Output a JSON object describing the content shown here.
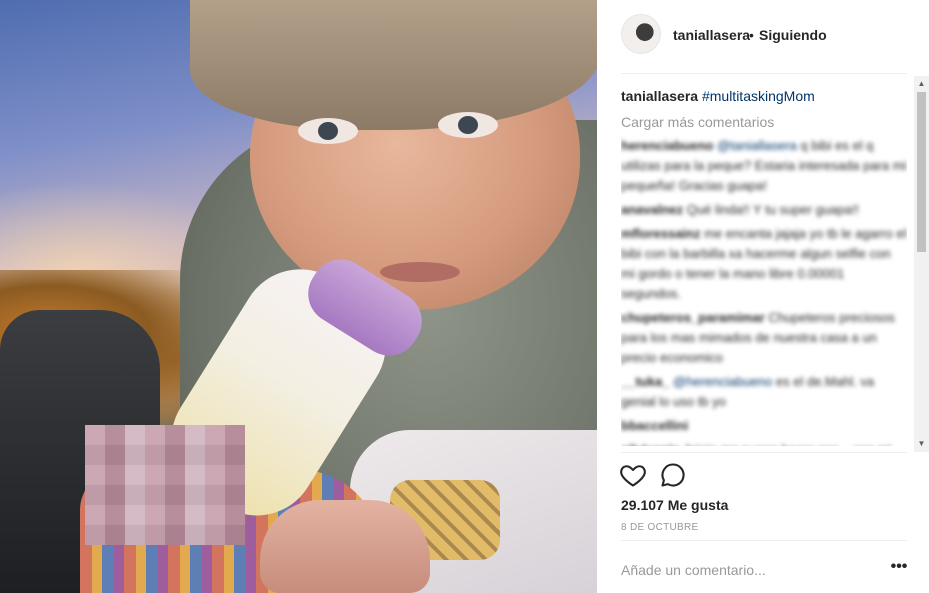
{
  "post": {
    "username": "taniallasera",
    "follow_dot": "•",
    "follow_status": "Siguiendo",
    "caption_user": "taniallasera",
    "caption_tag": "#multitaskingMom",
    "load_more": "Cargar más comentarios",
    "comments": [
      {
        "user": "herenciabueno",
        "mention": "@taniallasera",
        "text": "q bibi es el q utilizas para la peque? Estaria interesada para mi pequeña! Gracias guapa!"
      },
      {
        "user": "anavalnez",
        "mention": "",
        "text": "Qué linda!! Y tu super guapa!!"
      },
      {
        "user": "mfloressainz",
        "mention": "",
        "text": "me encanta jajaja yo tb le agarro el bibi con la barbilla xa hacerme algun selfie con mi gordo o tener la mano libre 0.00001 segundos."
      },
      {
        "user": "chupeteros_paramimar",
        "mention": "",
        "text": "Chupeteros preciosos para los mas mimados de nuestra casa a un precio economico"
      },
      {
        "user": "__tuka_",
        "mention": "@herenciabueno",
        "text": "es el de.Mahl. va genial lo uso tb yo"
      },
      {
        "user": "bbaccellini",
        "mention": "",
        "text": ""
      },
      {
        "user": "silvivenia",
        "mention": "",
        "text": "Jajaja me suena hacer eso ...con mi pequeña!"
      }
    ],
    "likes": "29.107 Me gusta",
    "date": "8 DE OCTUBRE",
    "add_comment_placeholder": "Añade un comentario...",
    "more_symbol": "•••"
  },
  "icons": {
    "avatar": "profile-avatar",
    "like": "heart-icon",
    "comment": "comment-bubble-icon",
    "more": "more-options-icon"
  },
  "colors": {
    "text": "#262626",
    "muted": "#999999",
    "link": "#003569",
    "divider": "#efefef"
  }
}
